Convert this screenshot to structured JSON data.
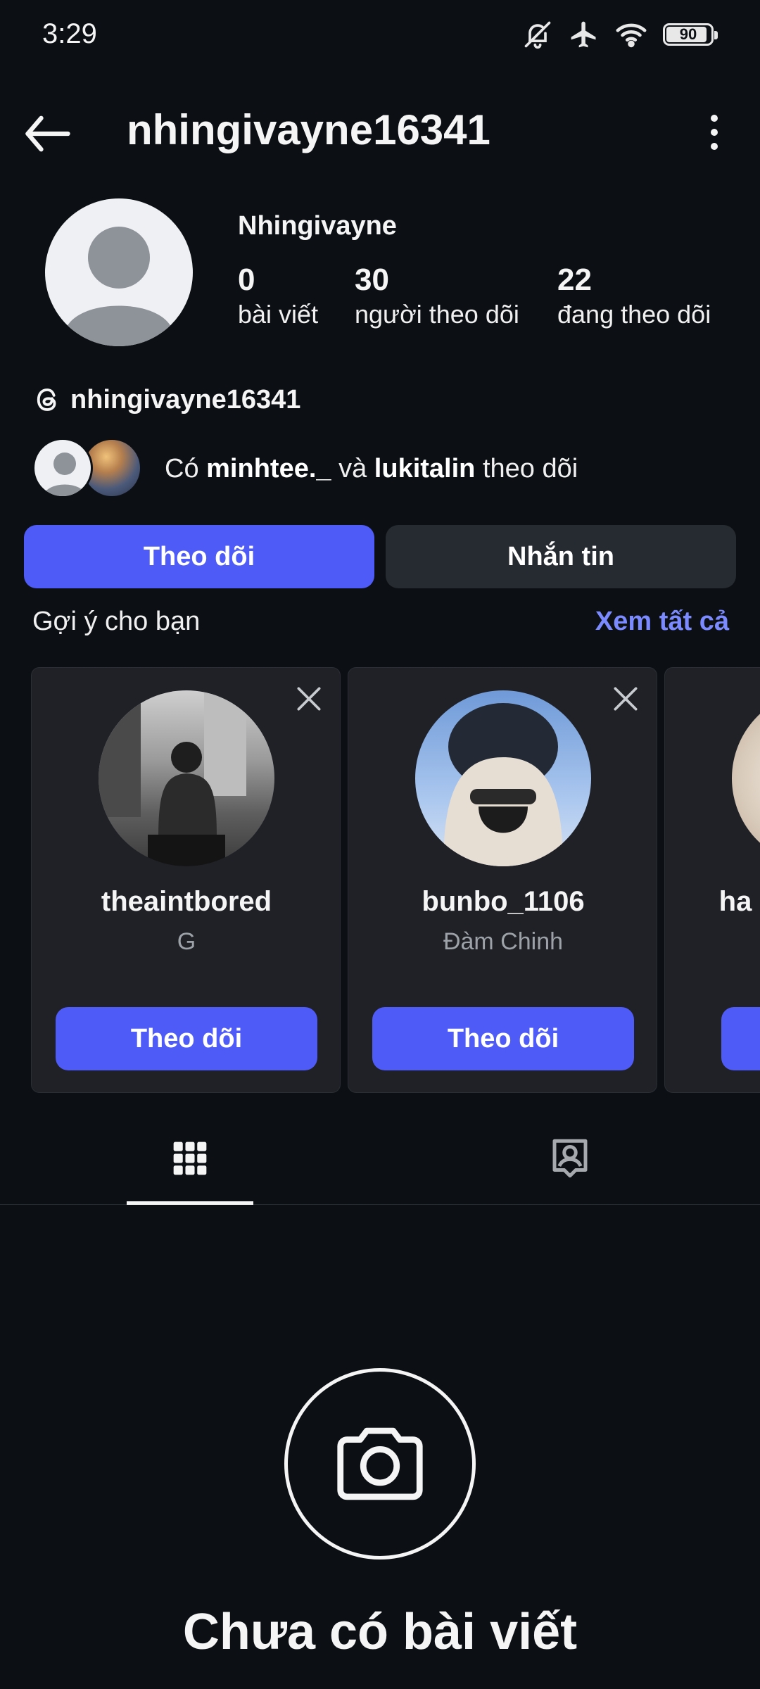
{
  "status_bar": {
    "time": "3:29",
    "battery": "90",
    "icons": [
      "mute-bell-icon",
      "airplane-icon",
      "wifi-icon",
      "battery-icon"
    ]
  },
  "header": {
    "username": "nhingivayne16341"
  },
  "profile": {
    "display_name": "Nhingivayne",
    "stats": [
      {
        "value": "0",
        "label": "bài viết"
      },
      {
        "value": "30",
        "label": "người theo dõi"
      },
      {
        "value": "22",
        "label": "đang theo dõi"
      }
    ],
    "threads_handle": "nhingivayne16341",
    "mutuals": {
      "prefix": "Có",
      "user1": "minhtee._",
      "conj": "và",
      "user2": "lukitalin",
      "suffix": "theo dõi"
    }
  },
  "actions": {
    "follow": "Theo dõi",
    "message": "Nhắn tin"
  },
  "suggestions": {
    "title": "Gợi ý cho bạn",
    "see_all": "Xem tất cả",
    "cards": [
      {
        "username": "theaintbored",
        "subtitle": "G",
        "button": "Theo dõi"
      },
      {
        "username": "bunbo_1106",
        "subtitle": "Đàm Chinh",
        "button": "Theo dõi"
      },
      {
        "username": "ha",
        "subtitle": "",
        "button": ""
      }
    ]
  },
  "tabs": [
    {
      "name": "grid",
      "icon": "grid-icon",
      "active": true
    },
    {
      "name": "tagged",
      "icon": "tagged-person-icon",
      "active": false
    }
  ],
  "empty_state": {
    "icon": "camera-icon",
    "title": "Chưa có bài viết"
  },
  "colors": {
    "background": "#0c1014",
    "primary": "#4f5bf6",
    "secondary_button": "#262a31",
    "link": "#7b8afe",
    "card": "#1f2127"
  }
}
